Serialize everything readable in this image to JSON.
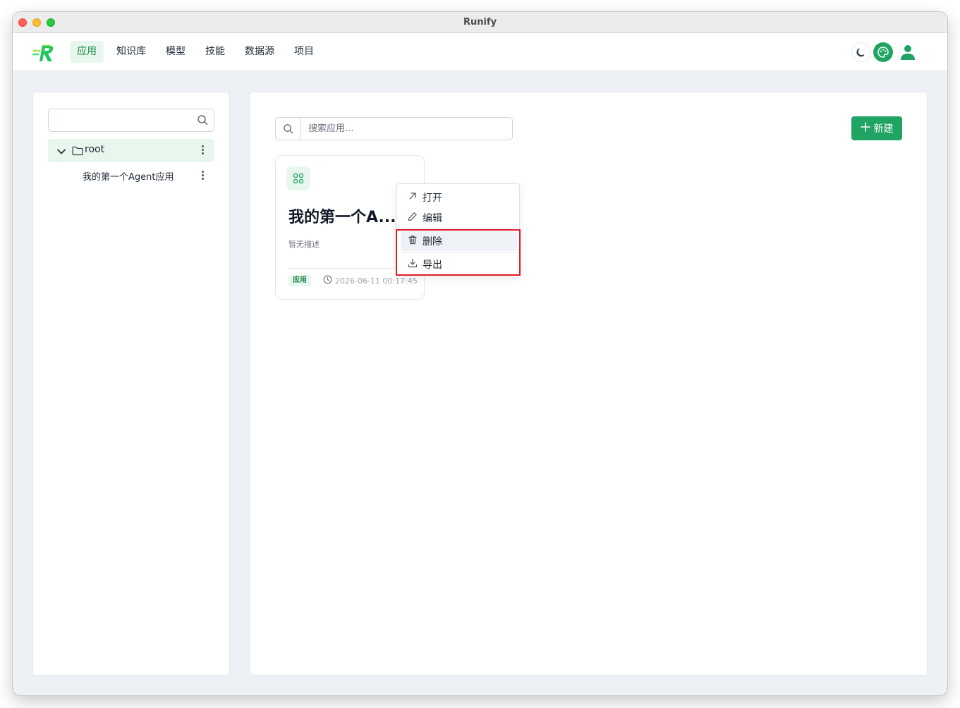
{
  "window": {
    "title": "Runify"
  },
  "nav": {
    "items": [
      {
        "label": "应用",
        "active": true
      },
      {
        "label": "知识库"
      },
      {
        "label": "模型"
      },
      {
        "label": "技能"
      },
      {
        "label": "数据源"
      },
      {
        "label": "项目"
      }
    ],
    "icons": [
      "moon-icon",
      "palette-icon",
      "user-icon"
    ]
  },
  "sidebar": {
    "search": {
      "value": "",
      "placeholder": ""
    },
    "tree": {
      "root_label": "root",
      "children": [
        {
          "label": "我的第一个Agent应用"
        }
      ]
    }
  },
  "main": {
    "search": {
      "placeholder": "搜索应用..."
    },
    "new_button_label": "新建",
    "cards": [
      {
        "title": "我的第一个A...",
        "description": "暂无描述",
        "tag": "应用",
        "timestamp": "2026-06-11 00:17:45"
      }
    ]
  },
  "context_menu": {
    "items": [
      {
        "label": "打开",
        "icon": "arrow-up-right-icon"
      },
      {
        "label": "编辑",
        "icon": "pencil-icon"
      },
      {
        "label": "删除",
        "icon": "trash-icon"
      },
      {
        "label": "导出",
        "icon": "download-icon"
      }
    ]
  },
  "colors": {
    "brand": "#1fa463",
    "active_bg": "#e8f7ee",
    "highlight": "#e11d2a"
  }
}
